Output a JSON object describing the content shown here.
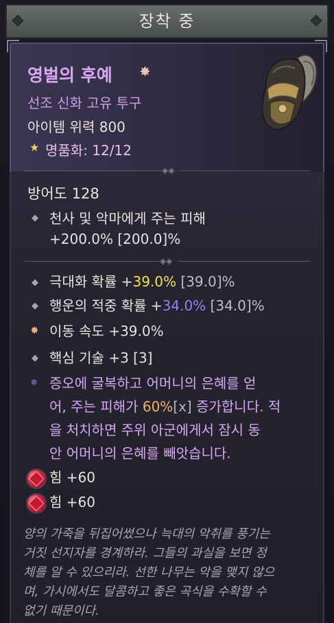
{
  "header": {
    "title": "장착 중"
  },
  "item": {
    "name": "영벌의 후예",
    "name_icon": "mythic-sun-icon",
    "type": "선조 신화 고유 투구",
    "power": "아이템 위력 800",
    "masterwork": "명품화: 12/12",
    "armor": "방어도 128",
    "implicit": {
      "line1": "천사 및 악마에게 주는 피해",
      "line2": "+200.0% [200.0]%"
    },
    "affixes": [
      {
        "label": "극대화 확률 +",
        "value": "39.0%",
        "range": " [39.0]%"
      },
      {
        "label": "행운의 적중 확률 +",
        "value": "34.0%",
        "range": " [34.0]%"
      },
      {
        "label": "이동 속도 +39.0%",
        "value": "",
        "range": ""
      },
      {
        "label": "핵심 기술 +3 [3]",
        "value": "",
        "range": ""
      }
    ],
    "legendary": {
      "line1": "증오에 굴복하고 어머니의 은혜를 얻",
      "line2a": "어, 주는 피해가 ",
      "line2b": "60%",
      "line2c": "[x]",
      "line2d": " 증가합니다. 적",
      "line3": "을 처치하면 주위 아군에게서 잠시 동",
      "line4": "안 어머니의 은혜를 빼앗습니다."
    },
    "sockets": [
      {
        "text": "힘 +60",
        "icon": "ruby-gem-icon"
      },
      {
        "text": "힘 +60",
        "icon": "ruby-gem-icon"
      }
    ],
    "flavor": [
      "양의 가죽을 뒤집어썼으나 늑대의 악취를 풍기는",
      "거짓 선지자를 경계하라. 그들의 과실을 보면 정",
      "체를 알 수 있으리라. 선한 나무는 악을 맺지 않으",
      "며, 가시에서도 달콤하고 좋은 곡식을 수확할 수",
      "없기 때문이다."
    ]
  },
  "colors": {
    "mythic_name": "#d7a9f0",
    "crit_value": "#f2e24a",
    "lucky_value": "#8c86f2",
    "legendary_text": "#d6a8f2",
    "legendary_value": "#f0b45c"
  }
}
